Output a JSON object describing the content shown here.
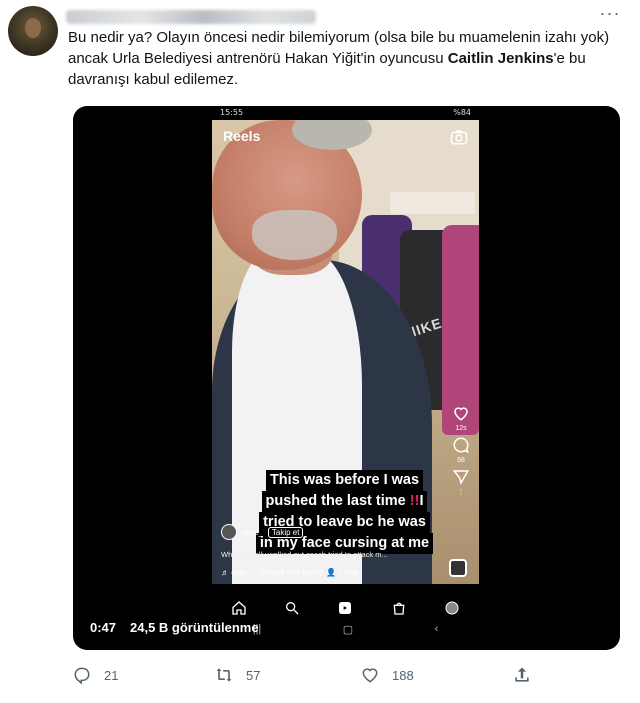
{
  "tweet": {
    "author_redacted": true,
    "text_part1": "Bu nedir ya? Olayın öncesi nedir bilemiyorum (olsa bile bu muamelenin izahı yok) ancak Urla Belediyesi antrenörü Hakan Yiğit'in oyuncusu ",
    "text_bold": "Caitlin Jenkins",
    "text_part2": "'e bu davranışı kabul edilemez.",
    "more_icon": "more-icon"
  },
  "video": {
    "phone_status_time": "15:55",
    "phone_status_right": "%84",
    "reels_label": "Reels",
    "side_counts": {
      "likes": "12s",
      "comments": "68"
    },
    "caption": {
      "line1": "This was before I was",
      "line2a": "pushed the last time",
      "line2b": "!!",
      "line2c": "I",
      "line3": "tried to leave bc he was",
      "line4": "in my face cursing at me"
    },
    "reel_username": "caije_",
    "follow_label": "Takip et",
    "reel_description": "When I finally walked out coach tried to attack m...",
    "audio_label": "♬ caije_ • Orijinal Ses İçeriği",
    "people_label": "👤 2 Kişi",
    "time": "0:47",
    "views": "24,5 B görüntülenme"
  },
  "actions": {
    "reply_count": "21",
    "retweet_count": "57",
    "like_count": "188"
  }
}
